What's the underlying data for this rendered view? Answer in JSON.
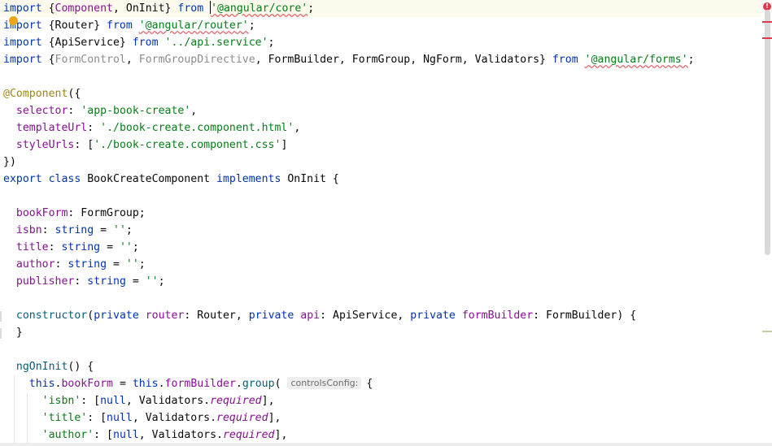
{
  "editor": {
    "lines": [
      [
        {
          "t": "import ",
          "c": "kw"
        },
        {
          "t": "{"
        },
        {
          "t": "Component",
          "c": "prop"
        },
        {
          "t": ", OnInit} "
        },
        {
          "t": "from ",
          "c": "kw"
        },
        {
          "caret": true
        },
        {
          "t": "'@angular/core'",
          "c": "str sq"
        },
        {
          "t": ";"
        }
      ],
      [
        {
          "t": "import ",
          "c": "kw"
        },
        {
          "t": "{Router} "
        },
        {
          "t": "from ",
          "c": "kw"
        },
        {
          "t": "'@angular/router'",
          "c": "str sq"
        },
        {
          "t": ";"
        }
      ],
      [
        {
          "t": "import ",
          "c": "kw"
        },
        {
          "t": "{ApiService} "
        },
        {
          "t": "from ",
          "c": "kw"
        },
        {
          "t": "'../api.service'",
          "c": "str"
        },
        {
          "t": ";"
        }
      ],
      [
        {
          "t": "import ",
          "c": "kw"
        },
        {
          "t": "{"
        },
        {
          "t": "FormControl",
          "c": "dim"
        },
        {
          "t": ", "
        },
        {
          "t": "FormGroupDirective",
          "c": "dim"
        },
        {
          "t": ", FormBuilder, FormGroup, NgForm, Validators} "
        },
        {
          "t": "from ",
          "c": "kw"
        },
        {
          "t": "'@angular/forms'",
          "c": "str sq"
        },
        {
          "t": ";"
        }
      ],
      [],
      [
        {
          "t": "@Component",
          "c": "ann"
        },
        {
          "t": "({"
        }
      ],
      [
        {
          "t": "  "
        },
        {
          "t": "selector",
          "c": "prop"
        },
        {
          "t": ": "
        },
        {
          "t": "'app-book-create'",
          "c": "str"
        },
        {
          "t": ","
        }
      ],
      [
        {
          "t": "  "
        },
        {
          "t": "templateUrl",
          "c": "prop"
        },
        {
          "t": ": "
        },
        {
          "t": "'./book-create.component.html'",
          "c": "str"
        },
        {
          "t": ","
        }
      ],
      [
        {
          "t": "  "
        },
        {
          "t": "styleUrls",
          "c": "prop"
        },
        {
          "t": ": ["
        },
        {
          "t": "'./book-create.component.css'",
          "c": "str"
        },
        {
          "t": "]"
        }
      ],
      [
        {
          "t": "})"
        }
      ],
      [
        {
          "t": "export ",
          "c": "kw"
        },
        {
          "t": "class ",
          "c": "kw"
        },
        {
          "t": "BookCreateComponent "
        },
        {
          "t": "implements ",
          "c": "kw"
        },
        {
          "t": "OnInit {"
        }
      ],
      [],
      [
        {
          "t": "  "
        },
        {
          "t": "bookForm",
          "c": "prop"
        },
        {
          "t": ": FormGroup;"
        }
      ],
      [
        {
          "t": "  "
        },
        {
          "t": "isbn",
          "c": "prop"
        },
        {
          "t": ": "
        },
        {
          "t": "string ",
          "c": "kw"
        },
        {
          "t": "= "
        },
        {
          "t": "''",
          "c": "str"
        },
        {
          "t": ";"
        }
      ],
      [
        {
          "t": "  "
        },
        {
          "t": "title",
          "c": "prop"
        },
        {
          "t": ": "
        },
        {
          "t": "string ",
          "c": "kw"
        },
        {
          "t": "= "
        },
        {
          "t": "''",
          "c": "str"
        },
        {
          "t": ";"
        }
      ],
      [
        {
          "t": "  "
        },
        {
          "t": "author",
          "c": "prop"
        },
        {
          "t": ": "
        },
        {
          "t": "string ",
          "c": "kw"
        },
        {
          "t": "= "
        },
        {
          "t": "''",
          "c": "str"
        },
        {
          "t": ";"
        }
      ],
      [
        {
          "t": "  "
        },
        {
          "t": "publisher",
          "c": "prop"
        },
        {
          "t": ": "
        },
        {
          "t": "string ",
          "c": "kw"
        },
        {
          "t": "= "
        },
        {
          "t": "''",
          "c": "str"
        },
        {
          "t": ";"
        }
      ],
      [],
      [
        {
          "t": "  "
        },
        {
          "t": "constructor",
          "c": "fn"
        },
        {
          "t": "("
        },
        {
          "t": "private ",
          "c": "kw"
        },
        {
          "t": "router",
          "c": "prop"
        },
        {
          "t": ": Router, "
        },
        {
          "t": "private ",
          "c": "kw"
        },
        {
          "t": "api",
          "c": "prop"
        },
        {
          "t": ": ApiService, "
        },
        {
          "t": "private ",
          "c": "kw"
        },
        {
          "t": "formBuilder",
          "c": "prop"
        },
        {
          "t": ": FormBuilder) {"
        }
      ],
      [
        {
          "t": "  }"
        }
      ],
      [],
      [
        {
          "t": "  "
        },
        {
          "t": "ngOnInit",
          "c": "fn"
        },
        {
          "t": "() {"
        }
      ],
      [
        {
          "t": "    "
        },
        {
          "t": "this",
          "c": "kw"
        },
        {
          "t": "."
        },
        {
          "t": "bookForm",
          "c": "prop"
        },
        {
          "t": " = "
        },
        {
          "t": "this",
          "c": "kw"
        },
        {
          "t": "."
        },
        {
          "t": "formBuilder",
          "c": "prop"
        },
        {
          "t": "."
        },
        {
          "t": "group",
          "c": "fn"
        },
        {
          "t": "( "
        },
        {
          "hint": "controlsConfig:"
        },
        {
          "t": "{"
        }
      ],
      [
        {
          "t": "      "
        },
        {
          "t": "'isbn'",
          "c": "str"
        },
        {
          "t": ": ["
        },
        {
          "t": "null",
          "c": "kw"
        },
        {
          "t": ", Validators."
        },
        {
          "t": "required",
          "c": "ital"
        },
        {
          "t": "],"
        }
      ],
      [
        {
          "t": "      "
        },
        {
          "t": "'title'",
          "c": "str"
        },
        {
          "t": ": ["
        },
        {
          "t": "null",
          "c": "kw"
        },
        {
          "t": ", Validators."
        },
        {
          "t": "required",
          "c": "ital"
        },
        {
          "t": "],"
        }
      ],
      [
        {
          "t": "      "
        },
        {
          "t": "'author'",
          "c": "str"
        },
        {
          "t": ": ["
        },
        {
          "t": "null",
          "c": "kw"
        },
        {
          "t": ", Validators."
        },
        {
          "t": "required",
          "c": "ital"
        },
        {
          "t": "],"
        }
      ]
    ]
  },
  "scrollbar": {
    "error_icon": "error-icon",
    "error_glyph": "!",
    "stripe_colors": [
      "#db3b4b",
      "#db3b4b",
      "#c8c8a0"
    ]
  },
  "colors": {
    "keyword": "#0033b3",
    "string": "#067d17",
    "property": "#871094",
    "function": "#00627a",
    "annotation": "#9e880d",
    "unused": "#8c8c8c",
    "current_line": "#fcfaed"
  },
  "intention_icon": "lightbulb-icon"
}
